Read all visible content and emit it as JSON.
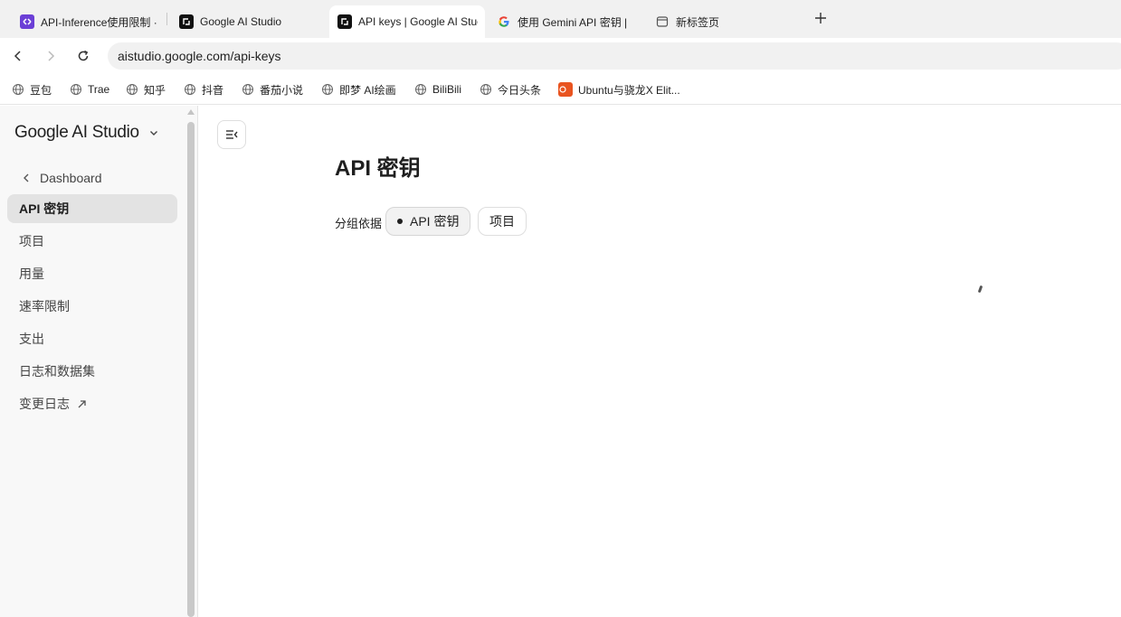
{
  "tabs": [
    {
      "label": "API-Inference使用限制 · ",
      "icon": "hf-icon",
      "active": false
    },
    {
      "label": "Google AI Studio",
      "icon": "aistudio-icon",
      "active": false
    },
    {
      "label": "API keys | Google AI Stuc",
      "icon": "aistudio-icon",
      "active": true
    },
    {
      "label": "使用 Gemini API 密钥 | ",
      "icon": "google-icon",
      "active": false
    },
    {
      "label": "新标签页",
      "icon": "newtab-page-icon",
      "active": false
    }
  ],
  "address": {
    "url": "aistudio.google.com/api-keys"
  },
  "bookmarks": [
    {
      "label": "豆包"
    },
    {
      "label": "Trae"
    },
    {
      "label": "知乎"
    },
    {
      "label": "抖音"
    },
    {
      "label": "番茄小说"
    },
    {
      "label": "即梦 AI绘画"
    },
    {
      "label": "BiliBili"
    },
    {
      "label": "今日头条"
    },
    {
      "label": "Ubuntu与骁龙X Elit..."
    }
  ],
  "sidebar": {
    "brand": "Google AI Studio",
    "back_label": "Dashboard",
    "items": [
      {
        "label": "API 密钥",
        "active": true
      },
      {
        "label": "项目"
      },
      {
        "label": "用量"
      },
      {
        "label": "速率限制"
      },
      {
        "label": "支出"
      },
      {
        "label": "日志和数据集"
      },
      {
        "label": "变更日志"
      }
    ]
  },
  "main": {
    "title": "API 密钥",
    "group_label": "分组依据",
    "chips": [
      {
        "label": "API 密钥",
        "selected": true
      },
      {
        "label": "项目",
        "selected": false
      }
    ]
  },
  "colors": {
    "accent_dark": "#1f1f1f",
    "sidebar_bg": "#f8f8f8",
    "active_item_bg": "#e3e3e3"
  }
}
